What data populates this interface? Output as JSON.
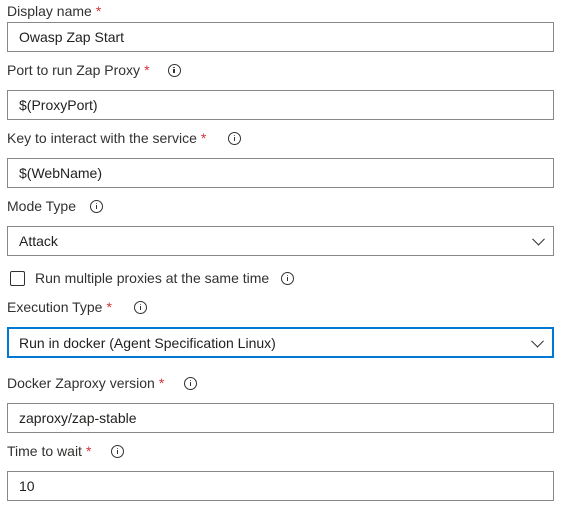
{
  "fields": {
    "display_name": {
      "label": "Display name",
      "required_mark": "*",
      "value": "Owasp Zap Start"
    },
    "zap_port": {
      "label": "Port to run Zap Proxy",
      "required_mark": "*",
      "value": "$(ProxyPort)",
      "icon": "info-icon"
    },
    "service_key": {
      "label": "Key to interact with the service",
      "required_mark": "*",
      "value": "$(WebName)",
      "icon": "info-icon"
    },
    "mode_type": {
      "label": "Mode Type",
      "value": "Attack",
      "icon": "info-icon"
    },
    "multiple_proxies": {
      "label": "Run multiple proxies at the same time",
      "checked": false,
      "icon": "info-icon"
    },
    "execution_type": {
      "label": "Execution Type",
      "required_mark": "*",
      "value": "Run in docker (Agent Specification Linux)",
      "icon": "info-icon"
    },
    "docker_version": {
      "label": "Docker Zaproxy version",
      "required_mark": "*",
      "value": "zaproxy/zap-stable",
      "icon": "info-icon"
    },
    "time_to_wait": {
      "label": "Time to wait",
      "required_mark": "*",
      "value": "10",
      "icon": "info-icon"
    }
  },
  "colors": {
    "required": "#d13438",
    "focus_border": "#0078d4",
    "field_border": "#8a8886"
  }
}
